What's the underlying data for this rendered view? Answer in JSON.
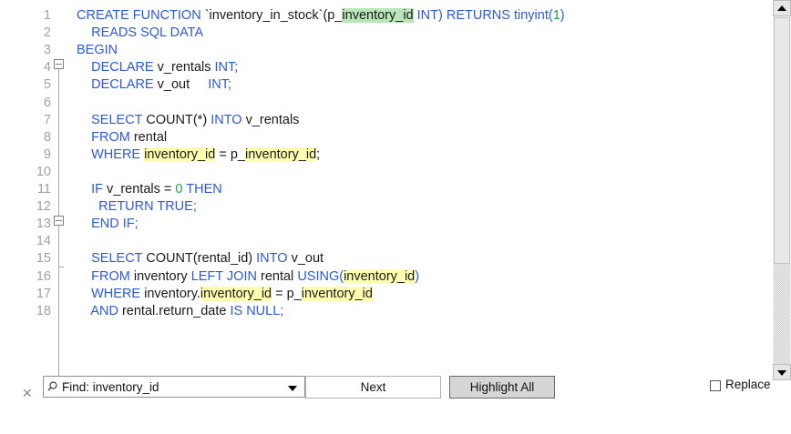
{
  "editor": {
    "lines": [
      {
        "n": "1",
        "segs": [
          {
            "t": "CREATE FUNCTION ",
            "c": "kw"
          },
          {
            "t": "`inventory_in_stock`(p_",
            "c": "tx"
          },
          {
            "t": "inventory_id",
            "c": "tx hlg"
          },
          {
            "t": " INT) RETURNS tinyint(",
            "c": "kw"
          },
          {
            "t": "1",
            "c": "num"
          },
          {
            "t": ")",
            "c": "kw"
          }
        ]
      },
      {
        "n": "2",
        "segs": [
          {
            "t": "    READS SQL DATA",
            "c": "kw"
          }
        ]
      },
      {
        "n": "3",
        "segs": [
          {
            "t": "BEGIN",
            "c": "kw"
          }
        ]
      },
      {
        "n": "4",
        "segs": [
          {
            "t": "    DECLARE ",
            "c": "kw"
          },
          {
            "t": "v_rentals ",
            "c": "tx"
          },
          {
            "t": "INT;",
            "c": "kw"
          }
        ]
      },
      {
        "n": "5",
        "segs": [
          {
            "t": "    DECLARE ",
            "c": "kw"
          },
          {
            "t": "v_out     ",
            "c": "tx"
          },
          {
            "t": "INT;",
            "c": "kw"
          }
        ]
      },
      {
        "n": "6",
        "segs": []
      },
      {
        "n": "7",
        "segs": [
          {
            "t": "    SELECT ",
            "c": "kw"
          },
          {
            "t": "COUNT(*) ",
            "c": "tx"
          },
          {
            "t": "INTO ",
            "c": "kw"
          },
          {
            "t": "v_rentals",
            "c": "tx"
          }
        ]
      },
      {
        "n": "8",
        "segs": [
          {
            "t": "    FROM ",
            "c": "kw"
          },
          {
            "t": "rental",
            "c": "tx"
          }
        ]
      },
      {
        "n": "9",
        "segs": [
          {
            "t": "    WHERE ",
            "c": "kw"
          },
          {
            "t": "inventory_id",
            "c": "tx hl"
          },
          {
            "t": " = p_",
            "c": "tx"
          },
          {
            "t": "inventory_id",
            "c": "tx hl"
          },
          {
            "t": ";",
            "c": "tx"
          }
        ]
      },
      {
        "n": "10",
        "segs": []
      },
      {
        "n": "11",
        "segs": [
          {
            "t": "    IF ",
            "c": "kw"
          },
          {
            "t": "v_rentals = ",
            "c": "tx"
          },
          {
            "t": "0",
            "c": "num"
          },
          {
            "t": " THEN",
            "c": "kw"
          }
        ]
      },
      {
        "n": "12",
        "segs": [
          {
            "t": "      RETURN TRUE;",
            "c": "kw"
          }
        ]
      },
      {
        "n": "13",
        "segs": [
          {
            "t": "    END IF;",
            "c": "kw"
          }
        ]
      },
      {
        "n": "14",
        "segs": []
      },
      {
        "n": "15",
        "segs": [
          {
            "t": "    SELECT ",
            "c": "kw"
          },
          {
            "t": "COUNT(rental_id) ",
            "c": "tx"
          },
          {
            "t": "INTO ",
            "c": "kw"
          },
          {
            "t": "v_out",
            "c": "tx"
          }
        ]
      },
      {
        "n": "16",
        "segs": [
          {
            "t": "    FROM ",
            "c": "kw"
          },
          {
            "t": "inventory ",
            "c": "tx"
          },
          {
            "t": "LEFT JOIN ",
            "c": "kw"
          },
          {
            "t": "rental ",
            "c": "tx"
          },
          {
            "t": "USING(",
            "c": "kw"
          },
          {
            "t": "inventory_id",
            "c": "tx hl"
          },
          {
            "t": ")",
            "c": "kw"
          }
        ]
      },
      {
        "n": "17",
        "segs": [
          {
            "t": "    WHERE ",
            "c": "kw"
          },
          {
            "t": "inventory.",
            "c": "tx"
          },
          {
            "t": "inventory_id",
            "c": "tx hl"
          },
          {
            "t": " = p_",
            "c": "tx"
          },
          {
            "t": "inventory_id",
            "c": "tx hl"
          }
        ]
      },
      {
        "n": "18",
        "segs": [
          {
            "t": "    AND ",
            "c": "kw"
          },
          {
            "t": "rental.return_date ",
            "c": "tx"
          },
          {
            "t": "IS NULL;",
            "c": "kw"
          }
        ]
      }
    ]
  },
  "findbar": {
    "close_icon": "close-icon",
    "search_icon": "search-icon",
    "find_text": "Find: inventory_id",
    "next_label": "Next",
    "highlight_all_label": "Highlight All",
    "replace_label": "Replace",
    "replace_checked": false
  },
  "colors": {
    "keyword": "#2a58e0",
    "text": "#1a1a1a",
    "number": "#1fa04b",
    "highlight": "#ffffb0",
    "highlight_current": "#b9e6b9"
  }
}
